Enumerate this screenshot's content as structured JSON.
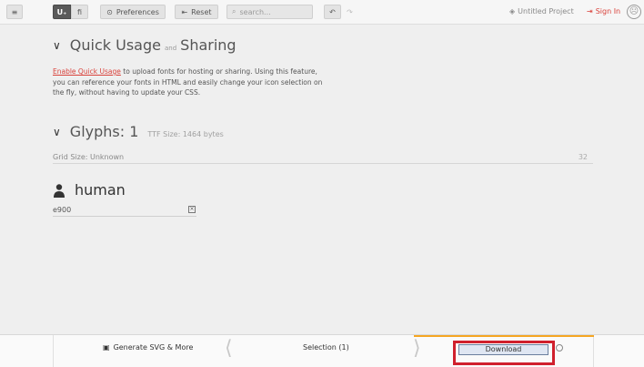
{
  "toolbar": {
    "mode1": "U₊",
    "mode2": "fi",
    "preferences": "Preferences",
    "reset": "Reset",
    "search_placeholder": "search...",
    "project": "Untitled Project",
    "signin": "Sign In"
  },
  "quick": {
    "title": "Quick Usage",
    "and": "and",
    "title2": "Sharing",
    "link": "Enable Quick Usage",
    "desc": " to upload fonts for hosting or sharing. Using this feature, you can reference your fonts in HTML and easily change your icon selection on the fly, without having to update your CSS."
  },
  "glyphs": {
    "title": "Glyphs: 1",
    "ttf": "TTF Size: 1464 bytes",
    "grid_label": "Grid Size: Unknown",
    "grid_value": "32"
  },
  "icon": {
    "name": "human",
    "code": "e900"
  },
  "bottom": {
    "generate": "Generate SVG & More",
    "selection": "Selection (1)",
    "download": "Download"
  }
}
